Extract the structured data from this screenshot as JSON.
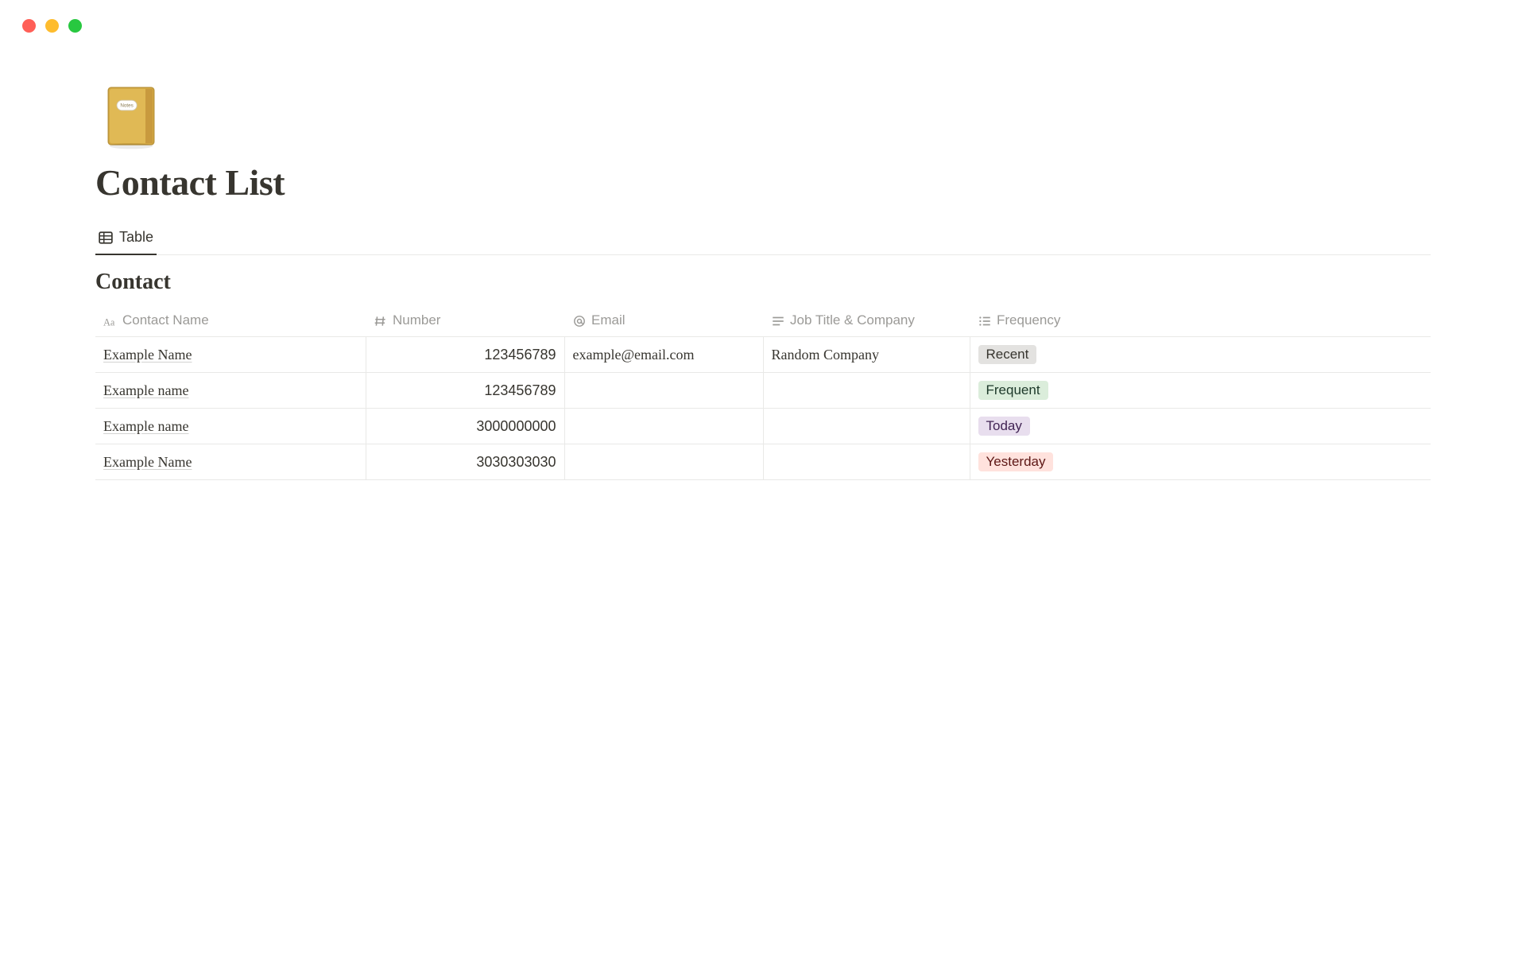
{
  "page": {
    "title": "Contact List",
    "iconLabel": "Notes"
  },
  "tabs": {
    "active": "Table"
  },
  "database": {
    "title": "Contact",
    "columns": {
      "name": "Contact Name",
      "number": "Number",
      "email": "Email",
      "job": "Job Title & Company",
      "frequency": "Frequency"
    },
    "rows": [
      {
        "name": "Example Name",
        "number": "123456789",
        "email": "example@email.com",
        "job": "Random Company",
        "frequency": "Recent",
        "freqColor": "gray"
      },
      {
        "name": "Example name",
        "number": "123456789",
        "email": "",
        "job": "",
        "frequency": "Frequent",
        "freqColor": "green"
      },
      {
        "name": "Example name",
        "number": "3000000000",
        "email": "",
        "job": "",
        "frequency": "Today",
        "freqColor": "purple"
      },
      {
        "name": "Example Name",
        "number": "3030303030",
        "email": "",
        "job": "",
        "frequency": "Yesterday",
        "freqColor": "red"
      }
    ]
  }
}
